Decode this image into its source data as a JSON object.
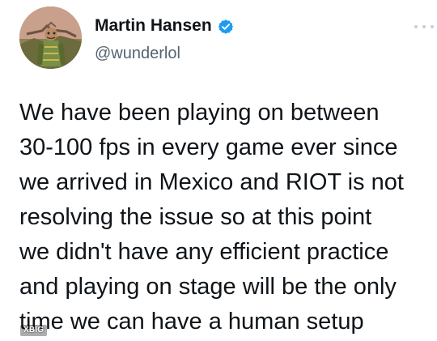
{
  "tweet": {
    "author": {
      "display_name": "Martin Hansen",
      "handle": "@wunderlol",
      "verified": true,
      "avatar_icon": "avatar-portrait-icon",
      "verified_icon": "verified-badge-icon"
    },
    "more_icon": "more-options-icon",
    "text_lines": [
      "We have been playing on between",
      "30-100 fps in every game ever since",
      "we arrived in Mexico and RIOT is not",
      "resolving the issue so at this point",
      "we didn't have any efficient practice",
      "and playing on stage will be the only",
      "time we can have a human setup"
    ]
  },
  "watermark": {
    "text": "XBIG",
    "icon": "weibo-watermark-icon"
  },
  "colors": {
    "background": "#ffffff",
    "primary_text": "#0f1419",
    "secondary_text": "#536471",
    "verified_blue": "#1d9bf0",
    "more_dots": "#c9ced3"
  }
}
